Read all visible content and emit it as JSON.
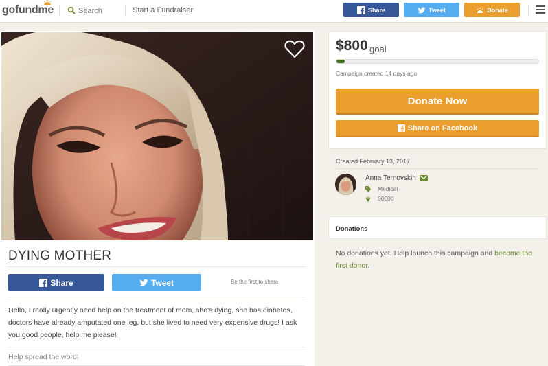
{
  "header": {
    "logo_text": "gofundme",
    "search_placeholder": "Search",
    "start_fundraiser": "Start a Fundraiser",
    "share_label": "Share",
    "tweet_label": "Tweet",
    "donate_label": "Donate"
  },
  "campaign": {
    "title": "DYING MOTHER",
    "share_label": "Share",
    "tweet_label": "Tweet",
    "first_to_share": "Be the first to share",
    "story": "Hello, I really urgently need help on the treatment of mom, she's dying, she has diabetes, doctors have already amputated one leg, but she lived to need very expensive drugs! I ask you good people, help me please!",
    "spread_word": "Help spread the word!"
  },
  "summary": {
    "amount": "$800",
    "goal_label": "goal",
    "progress_fraction": 0.04,
    "created_ago": "Campaign created 14 days ago",
    "donate_now": "Donate Now",
    "share_facebook": "Share on Facebook"
  },
  "organizer": {
    "created_date": "Created February 13, 2017",
    "name": "Anna Ternovskih",
    "category": "Medical",
    "location": "50000"
  },
  "donations": {
    "heading": "Donations",
    "empty_text": "No donations yet. Help launch this campaign and ",
    "empty_link": "become the first donor",
    "empty_suffix": "."
  },
  "colors": {
    "facebook_blue": "#365899",
    "twitter_blue": "#55acee",
    "donate_orange": "#e99e2e",
    "brand_green": "#3c6f1e"
  },
  "icons": [
    "gofundme-sun-icon",
    "search-icon",
    "facebook-icon",
    "twitter-icon",
    "heart-icon",
    "envelope-icon",
    "tag-icon",
    "location-pin-icon",
    "menu-icon"
  ]
}
